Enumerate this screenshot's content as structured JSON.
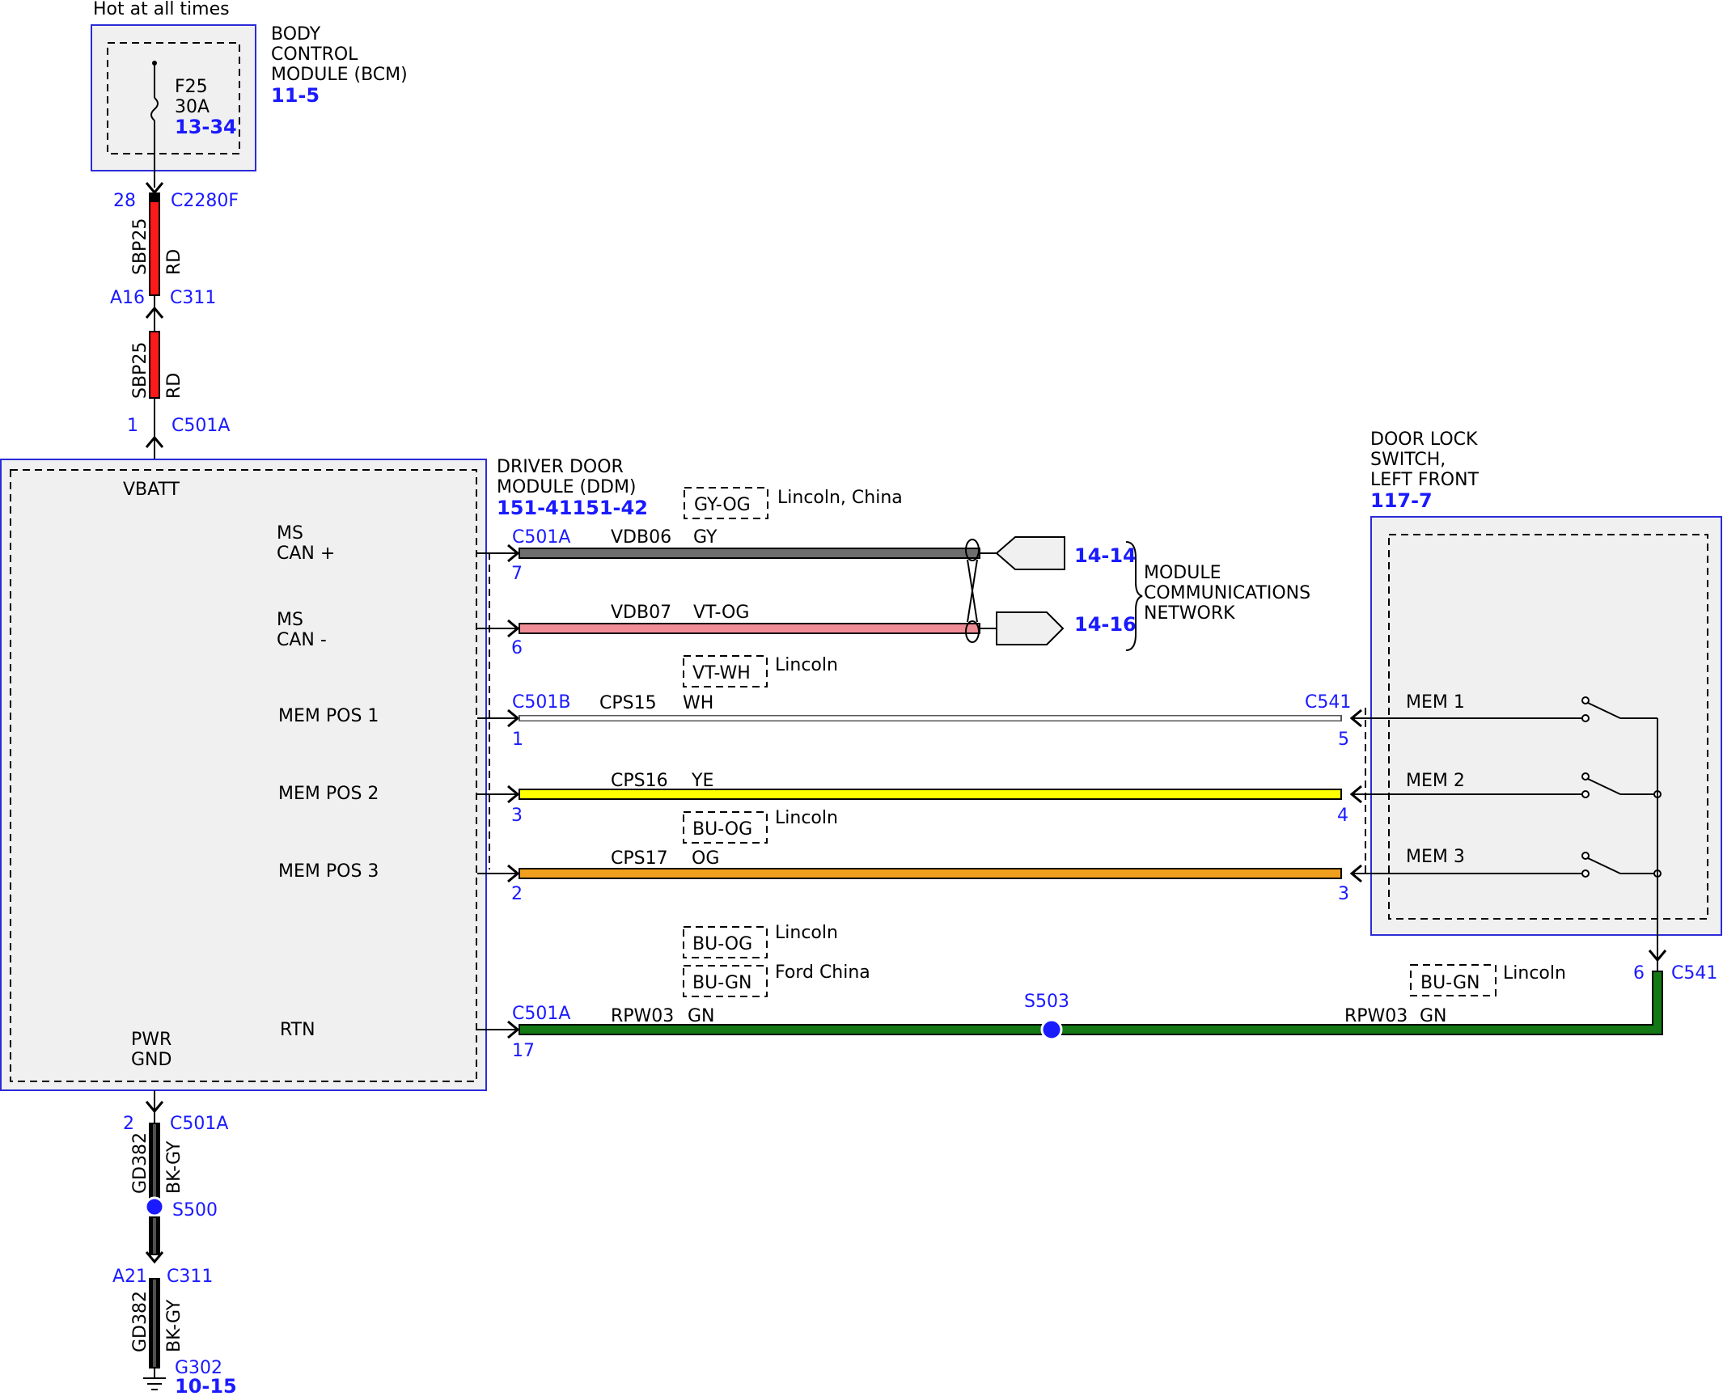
{
  "diagram": {
    "hot_label": "Hot at all times",
    "bcm": {
      "title_lines": [
        "BODY",
        "CONTROL",
        "MODULE (BCM)"
      ],
      "ref": "11-5",
      "fuse_name": "F25",
      "fuse_rating": "30A",
      "fuse_ref": "13-34"
    },
    "upper_wire": {
      "c2280f_pin": "28",
      "c2280f": "C2280F",
      "circuit": "SBP25",
      "color": "RD",
      "c311_pin": "A16",
      "c311": "C311",
      "c501a_pin": "1",
      "c501a": "C501A"
    },
    "ddm": {
      "title_lines": [
        "DRIVER DOOR",
        "MODULE (DDM)"
      ],
      "ref": "151-41151-42",
      "vbatt": "VBATT",
      "pwr_gnd_lines": [
        "PWR",
        "GND"
      ],
      "signals": {
        "ms_can_plus": [
          "MS",
          "CAN +"
        ],
        "ms_can_minus": [
          "MS",
          "CAN -"
        ],
        "mem_pos_1": "MEM POS 1",
        "mem_pos_2": "MEM POS 2",
        "mem_pos_3": "MEM POS 3",
        "rtn": "RTN"
      }
    },
    "wires": {
      "w_can_plus": {
        "connector": "C501A",
        "pin": "7",
        "circuit": "VDB06",
        "color": "GY",
        "hex": "#6e6e6e"
      },
      "w_can_minus": {
        "pin": "6",
        "circuit": "VDB07",
        "color": "VT-OG",
        "hex": "#f08c96"
      },
      "w_mem1": {
        "connector": "C501B",
        "pin": "1",
        "circuit": "CPS15",
        "color": "WH",
        "hex": "#ffffff",
        "far_connector": "C541",
        "far_pin": "5"
      },
      "w_mem2": {
        "pin": "3",
        "circuit": "CPS16",
        "color": "YE",
        "hex": "#ffff00",
        "far_pin": "4"
      },
      "w_mem3": {
        "pin": "2",
        "circuit": "CPS17",
        "color": "OG",
        "hex": "#f0a01e",
        "far_pin": "3"
      },
      "w_rtn": {
        "connector": "C501A",
        "pin": "17",
        "circuit": "RPW03",
        "color": "GN",
        "hex": "#147814",
        "right_circuit": "RPW03",
        "right_color": "GN"
      }
    },
    "variants": {
      "gy_og": {
        "box": "GY-OG",
        "note": "Lincoln, China"
      },
      "vt_wh": {
        "box": "VT-WH",
        "note": "Lincoln"
      },
      "bu_og_mem": {
        "box": "BU-OG",
        "note": "Lincoln"
      },
      "bu_og_rtn": {
        "box": "BU-OG",
        "note": "Lincoln"
      },
      "bu_gn_rtn": {
        "box": "BU-GN",
        "note": "Ford China"
      },
      "bu_gn_right": {
        "box": "BU-GN",
        "note": "Lincoln"
      }
    },
    "network": {
      "ref_top": "14-14",
      "ref_bottom": "14-16",
      "label_lines": [
        "MODULE",
        "COMMUNICATIONS",
        "NETWORK"
      ]
    },
    "switch": {
      "title_lines": [
        "DOOR LOCK",
        "SWITCH,",
        "LEFT FRONT"
      ],
      "ref": "117-7",
      "mem1": "MEM 1",
      "mem2": "MEM 2",
      "mem3": "MEM 3",
      "c541_pin": "6",
      "c541": "C541"
    },
    "splices": {
      "s503": "S503",
      "s500": "S500"
    },
    "ground": {
      "c501a_pin": "2",
      "c501a": "C501A",
      "circuit": "GD382",
      "color": "BK-GY",
      "c311_pin": "A21",
      "c311": "C311",
      "g302": "G302",
      "g302_ref": "10-15"
    }
  },
  "colors": {
    "accent_blue": "#1a1aff",
    "box_border": "#2b2bd9",
    "module_fill": "#f0f0f0",
    "red_wire": "#ff1a1a",
    "gray_wire": "#6e6e6e",
    "pink_wire": "#f08c96",
    "yellow_wire": "#ffff00",
    "orange_wire": "#f0a01e",
    "green_wire": "#147814"
  }
}
